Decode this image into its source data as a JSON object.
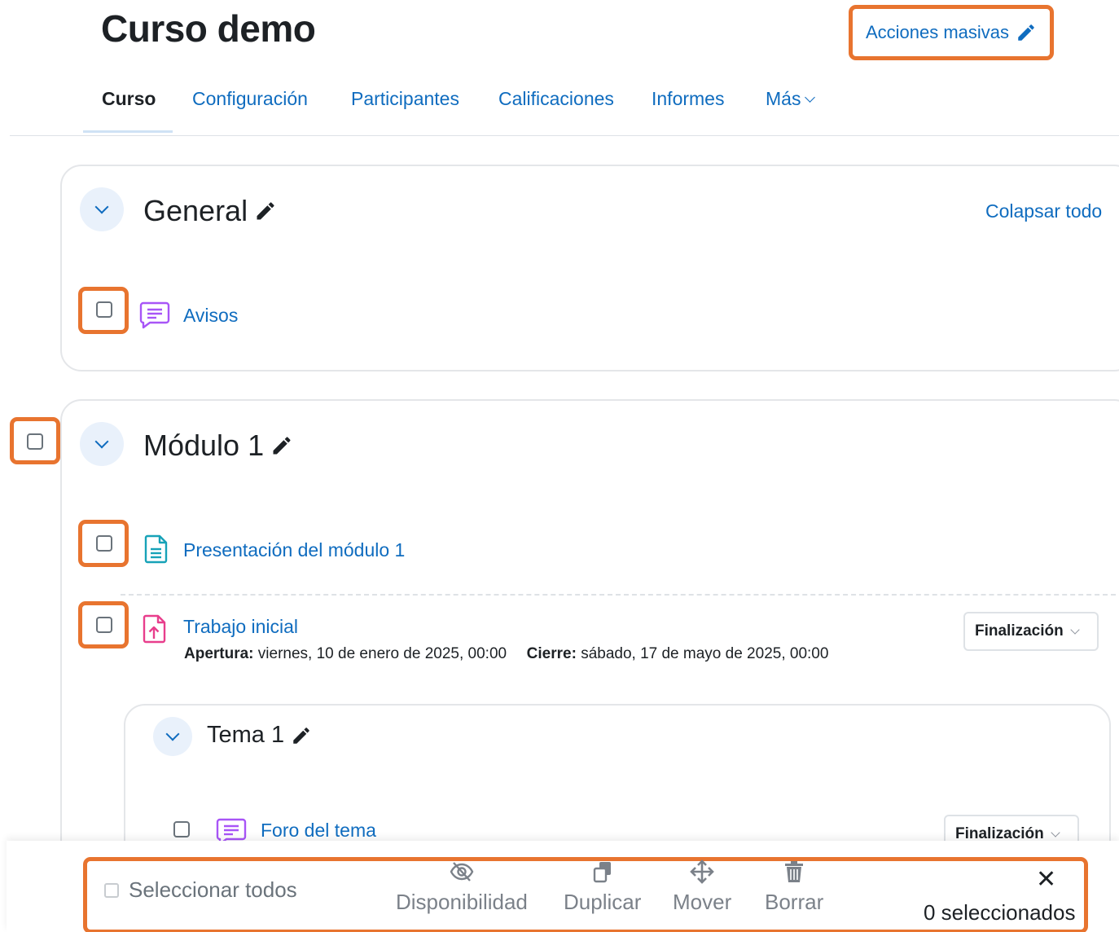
{
  "header": {
    "course_title": "Curso demo",
    "bulk_actions_label": "Acciones masivas"
  },
  "nav": {
    "tabs": [
      {
        "label": "Curso",
        "active": true
      },
      {
        "label": "Configuración"
      },
      {
        "label": "Participantes"
      },
      {
        "label": "Calificaciones"
      },
      {
        "label": "Informes"
      },
      {
        "label": "Más"
      }
    ]
  },
  "sections": [
    {
      "title": "General",
      "collapse_all_label": "Colapsar todo",
      "activities": [
        {
          "name": "Avisos",
          "icon": "forum-icon"
        }
      ]
    },
    {
      "title": "Módulo 1",
      "activities": [
        {
          "name": "Presentación del módulo 1",
          "icon": "page-icon"
        },
        {
          "name": "Trabajo inicial",
          "icon": "assignment-icon",
          "opening_label": "Apertura:",
          "opening_value": "viernes, 10 de enero de 2025, 00:00",
          "closing_label": "Cierre:",
          "closing_value": "sábado, 17 de mayo de 2025, 00:00",
          "completion_label": "Finalización"
        }
      ],
      "subsection": {
        "title": "Tema 1",
        "activities": [
          {
            "name": "Foro del tema",
            "icon": "forum-icon",
            "completion_label": "Finalización"
          }
        ]
      }
    }
  ],
  "bulk_bar": {
    "select_all_label": "Seleccionar todos",
    "actions": [
      {
        "label": "Disponibilidad",
        "icon": "eye-slash-icon"
      },
      {
        "label": "Duplicar",
        "icon": "copy-icon"
      },
      {
        "label": "Mover",
        "icon": "move-arrows-icon"
      },
      {
        "label": "Borrar",
        "icon": "trash-icon"
      }
    ],
    "selected_count_label": "0 seleccionados",
    "close_symbol": "✕"
  },
  "colors": {
    "link": "#0f6cbf",
    "highlight": "#e8742f",
    "forum_icon": "#a855f7",
    "page_icon": "#17a2b8",
    "assignment_icon": "#e83e8c"
  }
}
